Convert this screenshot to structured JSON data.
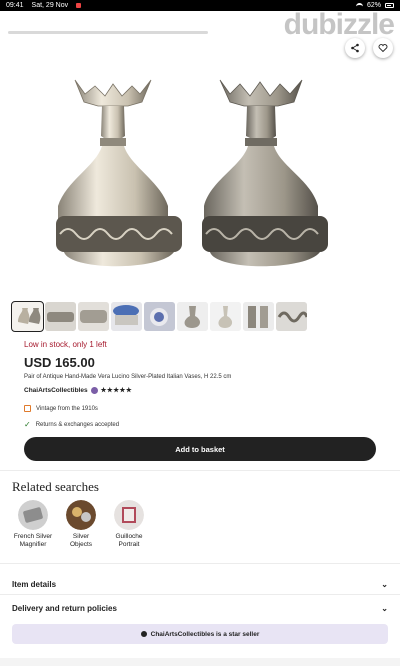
{
  "status_bar": {
    "time": "09:41",
    "date": "Sat, 29 Nov",
    "battery": "62%"
  },
  "watermark": "dubizzle",
  "icons": {
    "share": "share-icon",
    "favorite": "heart-icon",
    "vintage": "tag-icon",
    "returns": "check-icon",
    "star_seller": "star-seller-icon"
  },
  "listing": {
    "stock": "Low in stock, only 1 left",
    "price": "USD 165.00",
    "title": "Pair of Antique Hand-Made Vera Lucino Silver-Plated Italian Vases, H 22.5 cm",
    "seller": "ChaiArtsCollectibles",
    "rating_stars": "★★★★★",
    "rating_value": 5,
    "features": [
      "Vintage from the 1910s",
      "Returns & exchanges accepted"
    ],
    "add_button": "Add to basket"
  },
  "thumbnails_count": 9,
  "related": {
    "heading": "Related searches",
    "items": [
      {
        "line1": "French Silver",
        "line2": "Magnifier"
      },
      {
        "line1": "Silver",
        "line2": "Objects"
      },
      {
        "line1": "Guilloche",
        "line2": "Portrait"
      }
    ]
  },
  "accordions": {
    "item_details": "Item details",
    "delivery": "Delivery and return policies"
  },
  "banner": "ChaiArtsCollectibles is a star seller",
  "colors": {
    "stock_red": "#a61a2e",
    "button_dark": "#222222",
    "banner_bg": "#e8e4f4"
  }
}
